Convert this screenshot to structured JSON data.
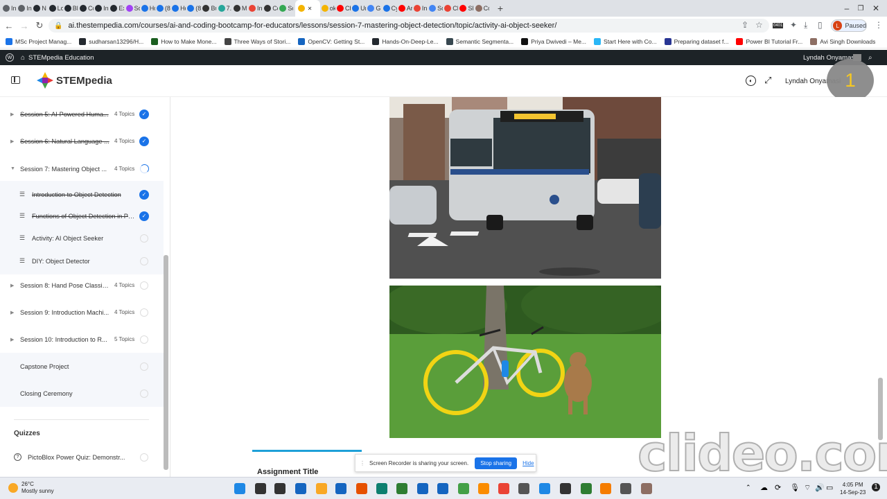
{
  "tabs": [
    {
      "label": "In",
      "icon": "globe-icon",
      "color": "#5f6368"
    },
    {
      "label": "In",
      "icon": "globe-icon",
      "color": "#5f6368"
    },
    {
      "label": "N",
      "icon": "github-icon",
      "color": "#24292f"
    },
    {
      "label": "Lo",
      "icon": "grid-icon",
      "color": "#24292f"
    },
    {
      "label": "Bl",
      "icon": "grid-icon",
      "color": "#24292f"
    },
    {
      "label": "Cc",
      "icon": "grid-icon",
      "color": "#24292f"
    },
    {
      "label": "In",
      "icon": "grid-icon",
      "color": "#24292f"
    },
    {
      "label": "Ex",
      "icon": "grid-icon",
      "color": "#24292f"
    },
    {
      "label": "Sc",
      "icon": "circle-icon",
      "color": "#a142f4"
    },
    {
      "label": "Hc",
      "icon": "c-icon",
      "color": "#1a73e8"
    },
    {
      "label": "(8)",
      "icon": "c-icon",
      "color": "#1a73e8"
    },
    {
      "label": "Hc",
      "icon": "c-icon",
      "color": "#1a73e8"
    },
    {
      "label": "(8)",
      "icon": "c-icon",
      "color": "#1a73e8"
    },
    {
      "label": "Bu",
      "icon": "wix-icon",
      "color": "#333"
    },
    {
      "label": "7.",
      "icon": "pin-icon",
      "color": "#26a69a"
    },
    {
      "label": "M",
      "icon": "oval-icon",
      "color": "#333"
    },
    {
      "label": "In",
      "icon": "gmail-icon",
      "color": "#ea4335"
    },
    {
      "label": "Cc",
      "icon": "card-icon",
      "color": "#333"
    },
    {
      "label": "Sc",
      "icon": "square-icon",
      "color": "#34a853"
    },
    {
      "label": "",
      "icon": "stempedia-icon",
      "color": "#f4b400",
      "active": true
    },
    {
      "label": "ok",
      "icon": "stempedia-icon",
      "color": "#f4b400"
    },
    {
      "label": "Ch",
      "icon": "youtube-icon",
      "color": "#ff0000"
    },
    {
      "label": "Ur",
      "icon": "c-icon",
      "color": "#1a73e8"
    },
    {
      "label": "Gr",
      "icon": "google-icon",
      "color": "#4285f4"
    },
    {
      "label": "Cy",
      "icon": "c-icon",
      "color": "#1a73e8"
    },
    {
      "label": "Ar",
      "icon": "youtube-icon",
      "color": "#ff0000"
    },
    {
      "label": "In",
      "icon": "gmail-icon",
      "color": "#ea4335"
    },
    {
      "label": "Sc",
      "icon": "google-icon",
      "color": "#4285f4"
    },
    {
      "label": "Ch",
      "icon": "square-icon",
      "color": "#ea4335"
    },
    {
      "label": "Sk",
      "icon": "youtube-icon",
      "color": "#ff0000"
    },
    {
      "label": "Cc",
      "icon": "avatar-icon",
      "color": "#8d6e63"
    }
  ],
  "address": {
    "url": "ai.thestempedia.com/courses/ai-and-coding-bootcamp-for-educators/lessons/session-7-mastering-object-detection/topic/activity-ai-object-seeker/"
  },
  "profile": {
    "initial": "L",
    "status": "Paused",
    "badge_count": "0401"
  },
  "bookmarks": [
    {
      "label": "MSc Project Manag...",
      "color": "#1a73e8"
    },
    {
      "label": "sudharsan13296/H...",
      "color": "#24292f"
    },
    {
      "label": "How to Make Mone...",
      "color": "#1b5e20"
    },
    {
      "label": "Three Ways of Stori...",
      "color": "#444"
    },
    {
      "label": "OpenCV: Getting St...",
      "color": "#1565c0"
    },
    {
      "label": "Hands-On-Deep-Le...",
      "color": "#24292f"
    },
    {
      "label": "Semantic Segmenta...",
      "color": "#37474f"
    },
    {
      "label": "Priya Dwivedi – Me...",
      "color": "#111"
    },
    {
      "label": "Start Here with Co...",
      "color": "#29b6f6"
    },
    {
      "label": "Preparing dataset f...",
      "color": "#283593"
    },
    {
      "label": "Power BI Tutorial Fr...",
      "color": "#ff0000"
    },
    {
      "label": "Avi Singh Downloads",
      "color": "#8d6e63"
    }
  ],
  "adminbar": {
    "site": "STEMpedia Education",
    "user": "Lyndah Onyamasi"
  },
  "header": {
    "logo": "STEMpedia",
    "user": "Lyndah Onyamasi",
    "badge": "1"
  },
  "sidebar": {
    "items": [
      {
        "label": "Session 5: AI-Powered Huma...",
        "count": "4 Topics",
        "status": "done",
        "strike": true,
        "type": "session",
        "expanded": false
      },
      {
        "label": "Session 6: Natural Language ...",
        "count": "4 Topics",
        "status": "done",
        "strike": true,
        "type": "session",
        "expanded": false
      },
      {
        "label": "Session 7: Mastering Object ...",
        "count": "4 Topics",
        "status": "progress",
        "strike": false,
        "type": "session",
        "expanded": true
      },
      {
        "label": "Introduction to Object Detection",
        "count": "",
        "status": "done",
        "strike": true,
        "type": "lesson"
      },
      {
        "label": "Functions of Object Detection in Pict...",
        "count": "",
        "status": "done",
        "strike": true,
        "type": "lesson"
      },
      {
        "label": "Activity: AI Object Seeker",
        "count": "",
        "status": "empty",
        "strike": false,
        "type": "lesson"
      },
      {
        "label": "DIY: Object Detector",
        "count": "",
        "status": "empty",
        "strike": false,
        "type": "lesson"
      },
      {
        "label": "Session 8: Hand Pose Classifi...",
        "count": "4 Topics",
        "status": "empty",
        "strike": false,
        "type": "session",
        "expanded": false
      },
      {
        "label": "Session 9: Introduction Machi...",
        "count": "4 Topics",
        "status": "empty",
        "strike": false,
        "type": "session",
        "expanded": false
      },
      {
        "label": "Session 10: Introduction to R...",
        "count": "5 Topics",
        "status": "empty",
        "strike": false,
        "type": "session",
        "expanded": false
      },
      {
        "label": "Capstone Project",
        "count": "",
        "status": "empty",
        "strike": false,
        "type": "plain"
      },
      {
        "label": "Closing Ceremony",
        "count": "",
        "status": "empty",
        "strike": false,
        "type": "plain"
      }
    ],
    "quizzes_title": "Quizzes",
    "quiz": "PictoBlox Power Quiz: Demonstr..."
  },
  "main": {
    "assignment_title": "Assignment Title"
  },
  "recorder": {
    "message": "Screen Recorder is sharing your screen.",
    "stop": "Stop sharing",
    "hide": "Hide"
  },
  "watermark": "clideo.com",
  "taskbar": {
    "temp": "26°C",
    "weather": "Mostly sunny",
    "time": "4:05 PM",
    "date": "14-Sep-23"
  },
  "colors": {
    "accent": "#1a73e8",
    "adminbar": "#1d2327",
    "tab_strip": "#dee1e6"
  }
}
